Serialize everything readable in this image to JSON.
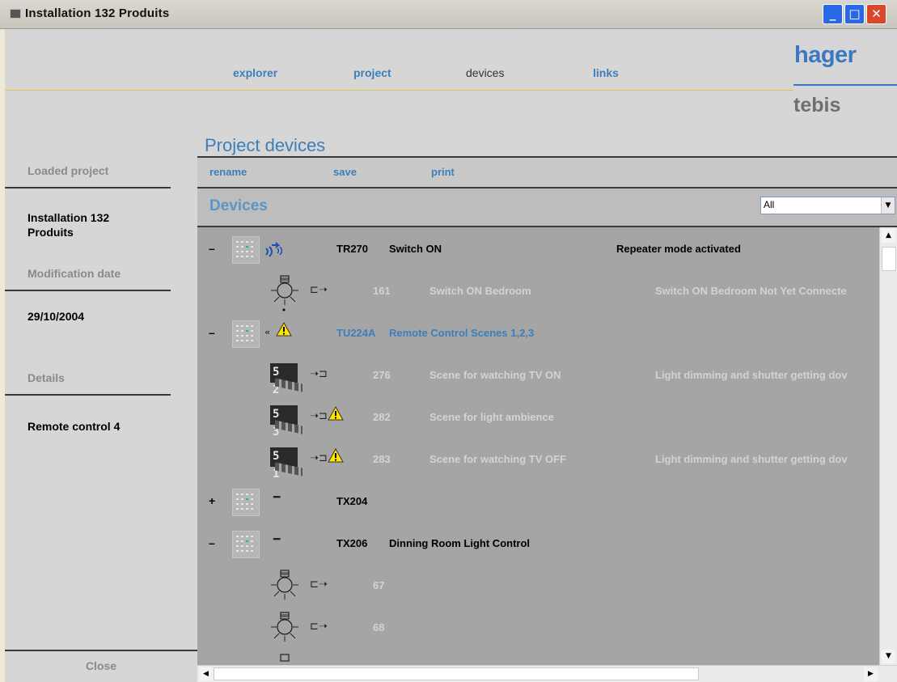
{
  "window": {
    "title": "Installation 132 Produits",
    "min": "_",
    "max": "□",
    "close": "✕"
  },
  "nav": {
    "explorer": "explorer",
    "project": "project",
    "devices": "devices",
    "links": "links"
  },
  "brand": {
    "top": "hager",
    "bottom": "tebis"
  },
  "left": {
    "loaded_label": "Loaded project",
    "loaded_value": "Installation 132 Produits",
    "mod_label": "Modification date",
    "mod_value": "29/10/2004",
    "details_label": "Details",
    "details_value": "Remote control 4",
    "close": "Close"
  },
  "main": {
    "title": "Project devices",
    "toolbar": {
      "rename": "rename",
      "save": "save",
      "print": "print"
    },
    "devices_title": "Devices",
    "filter": "All"
  },
  "devices": [
    {
      "toggle": "–",
      "code": "TR270",
      "name": "Switch ON",
      "desc": "Repeater mode activated"
    },
    {
      "code": "161",
      "name": "Switch ON Bedroom",
      "desc": "Switch ON Bedroom Not Yet Connecte"
    },
    {
      "toggle": "–",
      "code": "TU224A",
      "name": "Remote Control Scenes 1,2,3",
      "desc": ""
    },
    {
      "scene": "5 2",
      "code": "276",
      "name": "Scene for watching TV ON",
      "desc": "Light dimming and shutter getting dov"
    },
    {
      "scene": "5 3",
      "code": "282",
      "name": "Scene for light ambience",
      "desc": ""
    },
    {
      "scene": "5 1",
      "code": "283",
      "name": "Scene for watching TV OFF",
      "desc": "Light dimming and shutter getting dov"
    },
    {
      "toggle": "+",
      "code": "TX204",
      "name": "",
      "desc": ""
    },
    {
      "toggle": "–",
      "code": "TX206",
      "name": "Dinning Room Light Control",
      "desc": ""
    },
    {
      "code": "67",
      "name": "",
      "desc": ""
    },
    {
      "code": "68",
      "name": "",
      "desc": ""
    }
  ]
}
